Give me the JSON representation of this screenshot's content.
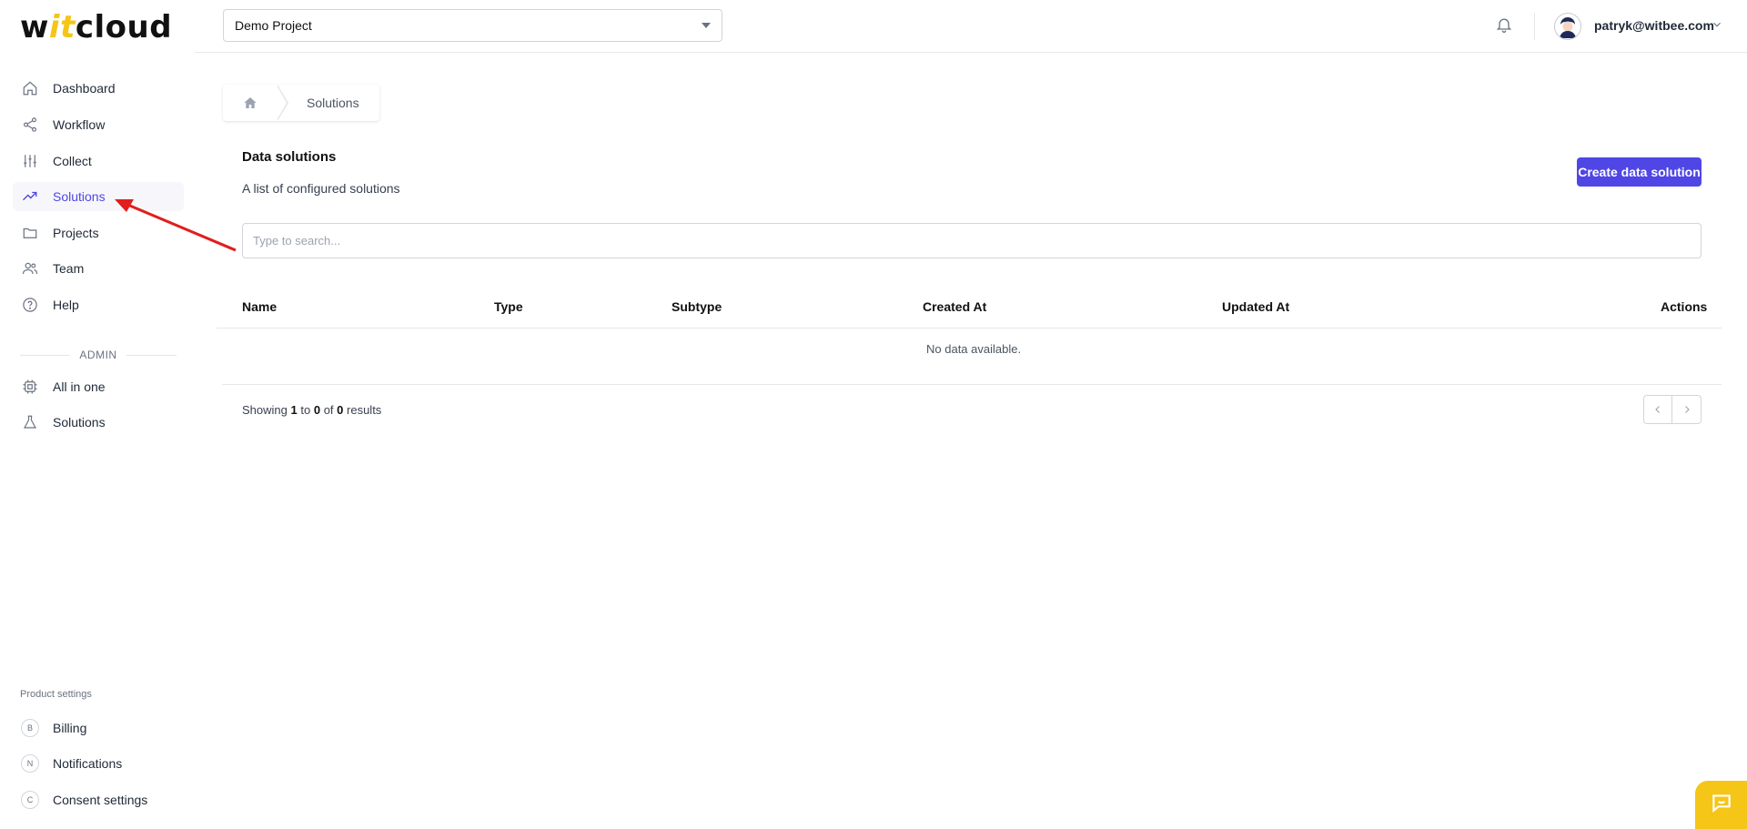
{
  "app": {
    "logo_prefix": "w",
    "logo_accent": "it",
    "logo_suffix": "cloud"
  },
  "sidebar": {
    "items": [
      {
        "label": "Dashboard",
        "icon": "home-icon"
      },
      {
        "label": "Workflow",
        "icon": "share-icon"
      },
      {
        "label": "Collect",
        "icon": "sliders-icon"
      },
      {
        "label": "Solutions",
        "icon": "trending-up-icon",
        "active": true
      },
      {
        "label": "Projects",
        "icon": "folder-icon"
      },
      {
        "label": "Team",
        "icon": "users-icon"
      },
      {
        "label": "Help",
        "icon": "help-circle-icon"
      }
    ],
    "admin_label": "ADMIN",
    "admin_items": [
      {
        "label": "All in one",
        "icon": "cpu-icon"
      },
      {
        "label": "Solutions",
        "icon": "flask-icon"
      }
    ],
    "product_settings_label": "Product settings",
    "settings_items": [
      {
        "label": "Billing",
        "badge": "B"
      },
      {
        "label": "Notifications",
        "badge": "N"
      },
      {
        "label": "Consent settings",
        "badge": "C"
      }
    ]
  },
  "header": {
    "project": "Demo Project",
    "user_email": "patryk@witbee.com"
  },
  "breadcrumb": {
    "current": "Solutions"
  },
  "main": {
    "title": "Data solutions",
    "description": "A list of configured solutions",
    "create_button": "Create data solution",
    "search_placeholder": "Type to search...",
    "columns": [
      "Name",
      "Type",
      "Subtype",
      "Created At",
      "Updated At",
      "Actions"
    ],
    "empty_text": "No data available.",
    "showing": {
      "prefix": "Showing",
      "from": "1",
      "to_word": "to",
      "to": "0",
      "of_word": "of",
      "total": "0",
      "suffix": "results"
    }
  },
  "colors": {
    "accent": "#4f46e5",
    "brand_yellow": "#f5c518",
    "annotation_red": "#e11d1d"
  }
}
